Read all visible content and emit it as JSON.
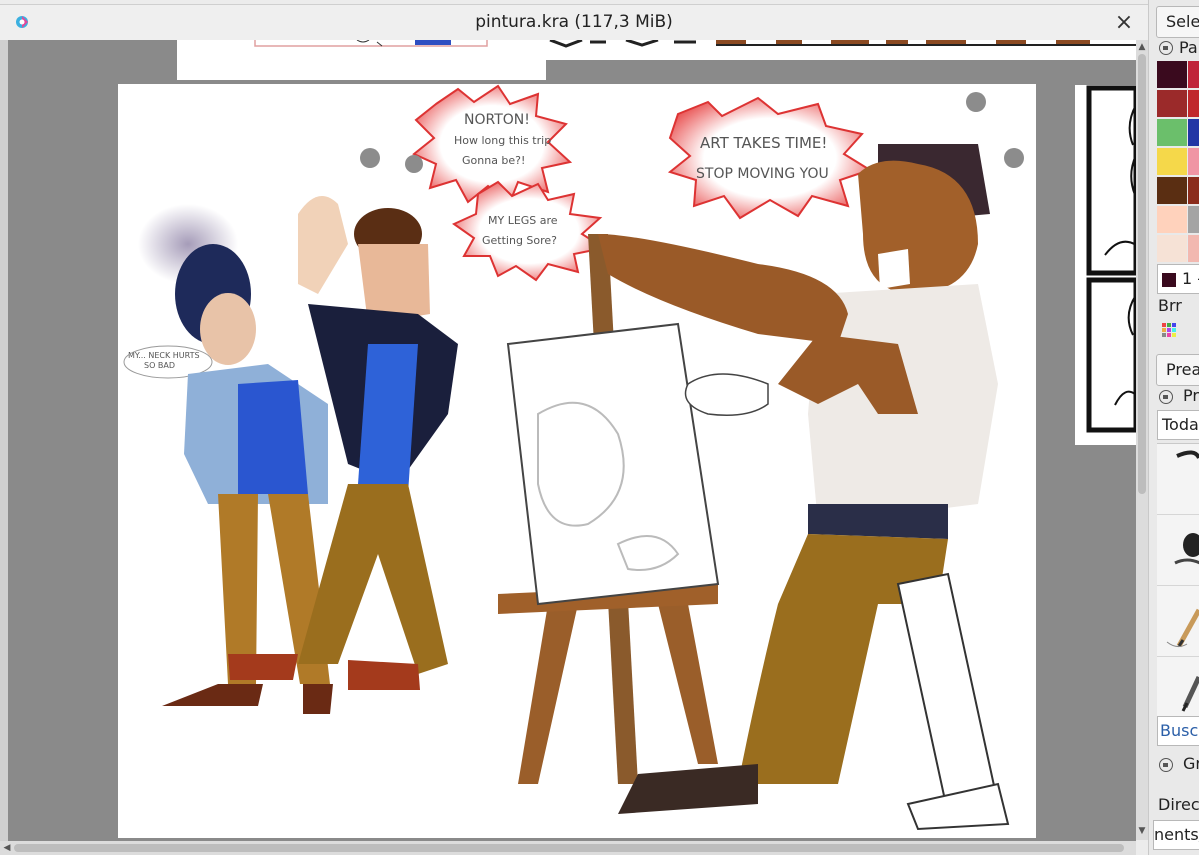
{
  "window": {
    "title": "pintura.kra (117,3 MiB)",
    "close_glyph": "×"
  },
  "docker": {
    "select_label": "Sele",
    "palette_title": "Pa",
    "palette_colors": [
      "#3a0a1e",
      "#9b2a2a",
      "#6bbf6b",
      "#f5d84a",
      "#5a2e12",
      "#ffd2bc",
      "#f6e2d6"
    ],
    "palette_colors_2": [
      "#c0243a",
      "#c0282c",
      "#2236a5",
      "#f095a4",
      "#8b2c1c",
      "#a4a4a4",
      "#f2b8b0"
    ],
    "layer_combo": "1 -",
    "brush_name": "Brr",
    "presets_tab": "Prea",
    "presets_title": "Pr",
    "tag_combo": "Toda",
    "search_field": "Busc",
    "gr_label": "Gr",
    "directory_label": "Direc",
    "path_field": "nents/"
  },
  "colors": {
    "canvas_bg": "#8a8a8a",
    "titlebar": "#efefef",
    "docker_bg": "#e9e9e9"
  }
}
